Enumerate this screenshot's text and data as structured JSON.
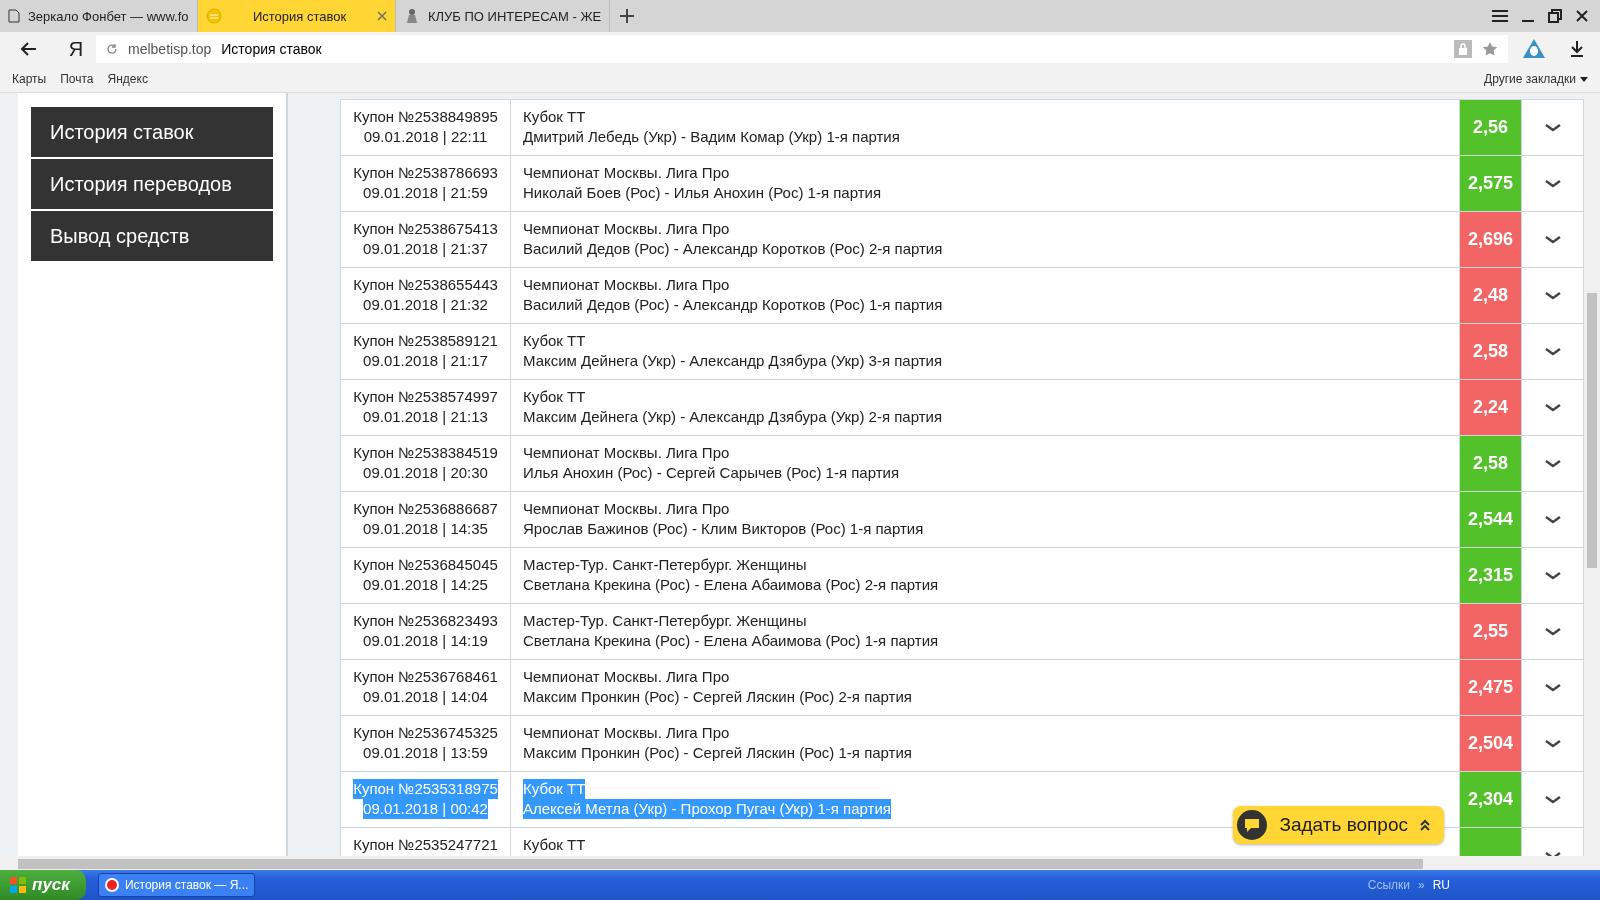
{
  "browser": {
    "tabs": [
      {
        "title": "Зеркало Фонбет — www.fo",
        "selected": false,
        "kind": "page"
      },
      {
        "title": "История ставок",
        "selected": true,
        "kind": "coin"
      },
      {
        "title": "КЛУБ ПО ИНТЕРЕСАМ - ЖЕ",
        "selected": false,
        "kind": "figure"
      }
    ],
    "address": {
      "domain": "melbetisp.top",
      "title": "История ставок"
    },
    "logo": "Я",
    "bookmarks": [
      "Карты",
      "Почта",
      "Яндекс"
    ],
    "other_bookmarks": "Другие закладки"
  },
  "sidebar": {
    "items": [
      "История ставок",
      "История переводов",
      "Вывод средств"
    ]
  },
  "bets": [
    {
      "coupon": "Купон №2538849895",
      "datetime": "09.01.2018 | 22:11",
      "tournament": "Кубок ТТ",
      "match": "Дмитрий Лебедь (Укр) - Вадим Комар (Укр) 1-я партия",
      "odds": "2,56",
      "color": "#53c12a",
      "selected": false
    },
    {
      "coupon": "Купон №2538786693",
      "datetime": "09.01.2018 | 21:59",
      "tournament": "Чемпионат Москвы. Лига Про",
      "match": "Николай Боев (Рос) - Илья Анохин (Рос) 1-я партия",
      "odds": "2,575",
      "color": "#53c12a",
      "selected": false
    },
    {
      "coupon": "Купон №2538675413",
      "datetime": "09.01.2018 | 21:37",
      "tournament": "Чемпионат Москвы. Лига Про",
      "match": "Василий Дедов (Рос) - Александр Коротков (Рос) 2-я партия",
      "odds": "2,696",
      "color": "#f36565",
      "selected": false
    },
    {
      "coupon": "Купон №2538655443",
      "datetime": "09.01.2018 | 21:32",
      "tournament": "Чемпионат Москвы. Лига Про",
      "match": "Василий Дедов (Рос) - Александр Коротков (Рос) 1-я партия",
      "odds": "2,48",
      "color": "#f36565",
      "selected": false
    },
    {
      "coupon": "Купон №2538589121",
      "datetime": "09.01.2018 | 21:17",
      "tournament": "Кубок ТТ",
      "match": "Максим Дейнега (Укр) - Александр Дзябура (Укр) 3-я партия",
      "odds": "2,58",
      "color": "#f36565",
      "selected": false
    },
    {
      "coupon": "Купон №2538574997",
      "datetime": "09.01.2018 | 21:13",
      "tournament": "Кубок ТТ",
      "match": "Максим Дейнега (Укр) - Александр Дзябура (Укр) 2-я партия",
      "odds": "2,24",
      "color": "#f36565",
      "selected": false
    },
    {
      "coupon": "Купон №2538384519",
      "datetime": "09.01.2018 | 20:30",
      "tournament": "Чемпионат Москвы. Лига Про",
      "match": "Илья Анохин (Рос) - Сергей Сарычев (Рос) 1-я партия",
      "odds": "2,58",
      "color": "#53c12a",
      "selected": false
    },
    {
      "coupon": "Купон №2536886687",
      "datetime": "09.01.2018 | 14:35",
      "tournament": "Чемпионат Москвы. Лига Про",
      "match": "Ярослав Бажинов (Рос) - Клим Викторов (Рос) 1-я партия",
      "odds": "2,544",
      "color": "#53c12a",
      "selected": false
    },
    {
      "coupon": "Купон №2536845045",
      "datetime": "09.01.2018 | 14:25",
      "tournament": "Мастер-Тур. Санкт-Петербург. Женщины",
      "match": "Светлана Крекина (Рос) - Елена Абаимова (Рос) 2-я партия",
      "odds": "2,315",
      "color": "#53c12a",
      "selected": false
    },
    {
      "coupon": "Купон №2536823493",
      "datetime": "09.01.2018 | 14:19",
      "tournament": "Мастер-Тур. Санкт-Петербург. Женщины",
      "match": "Светлана Крекина (Рос) - Елена Абаимова (Рос) 1-я партия",
      "odds": "2,55",
      "color": "#f36565",
      "selected": false
    },
    {
      "coupon": "Купон №2536768461",
      "datetime": "09.01.2018 | 14:04",
      "tournament": "Чемпионат Москвы. Лига Про",
      "match": "Максим Пронкин (Рос) - Сергей Ляскин (Рос) 2-я партия",
      "odds": "2,475",
      "color": "#f36565",
      "selected": false
    },
    {
      "coupon": "Купон №2536745325",
      "datetime": "09.01.2018 | 13:59",
      "tournament": "Чемпионат Москвы. Лига Про",
      "match": "Максим Пронкин (Рос) - Сергей Ляскин (Рос) 1-я партия",
      "odds": "2,504",
      "color": "#f36565",
      "selected": false
    },
    {
      "coupon": "Купон №2535318975",
      "datetime": "09.01.2018 | 00:42",
      "tournament": "Кубок ТТ",
      "match": "Алексей Метла (Укр) - Прохор Пугач (Укр) 1-я партия",
      "odds": "2,304",
      "color": "#53c12a",
      "selected": true
    },
    {
      "coupon": "Купон №2535247721",
      "tournament": "Кубок ТТ",
      "color": "#53c12a",
      "selected": false
    }
  ],
  "chat_button": {
    "label": "Задать вопрос"
  },
  "taskbar": {
    "start": "пуск",
    "tasks": [
      "История ставок — Я..."
    ],
    "links": "Ссылки",
    "chevron": "»",
    "language": "RU"
  }
}
